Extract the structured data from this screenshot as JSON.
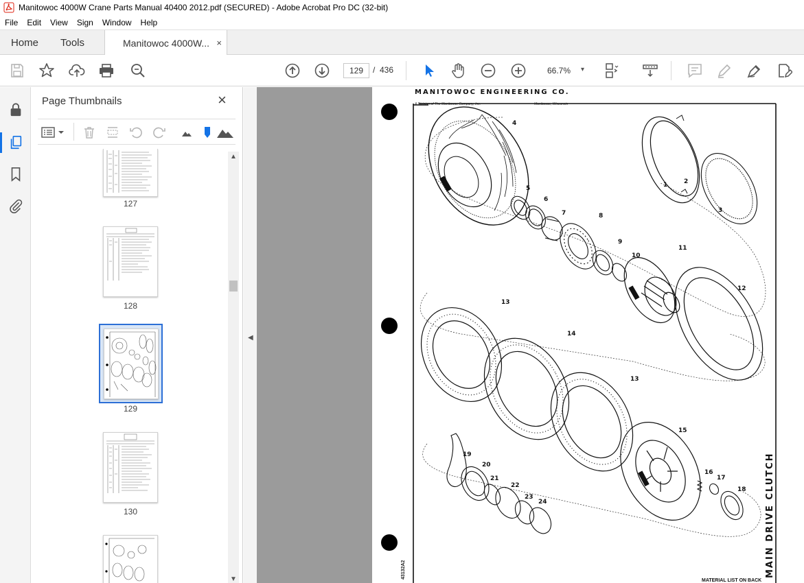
{
  "window": {
    "title": "Manitowoc 4000W Crane Parts Manual 40400 2012.pdf (SECURED) - Adobe Acrobat Pro DC (32-bit)"
  },
  "menu": {
    "items": [
      "File",
      "Edit",
      "View",
      "Sign",
      "Window",
      "Help"
    ]
  },
  "tabs": {
    "home": "Home",
    "tools": "Tools",
    "document": "Manitowoc 4000W...",
    "close": "×"
  },
  "toolbar": {
    "current_page": "129",
    "separator": "/",
    "total_pages": "436",
    "zoom": "66.7%",
    "zoom_chevron": "▾"
  },
  "panel": {
    "title": "Page Thumbnails",
    "close": "×",
    "thumbnails": [
      {
        "label": "127"
      },
      {
        "label": "128"
      },
      {
        "label": "129",
        "selected": true
      },
      {
        "label": "130"
      }
    ]
  },
  "document": {
    "company": "MANITOWOC ENGINEERING CO.",
    "division": "A Division of The Manitowoc Company, Inc.",
    "location": "Manitowoc, Wisconsin",
    "side_title": "MAIN DRIVE CLUTCH",
    "drawing_code": "43132A2",
    "footer": "MATERIAL LIST ON BACK",
    "part_numbers": [
      "1",
      "2",
      "3",
      "4",
      "5",
      "6",
      "7",
      "8",
      "9",
      "10",
      "11",
      "12",
      "13",
      "14",
      "13",
      "15",
      "16",
      "17",
      "18",
      "19",
      "20",
      "21",
      "22",
      "23",
      "24"
    ]
  },
  "colors": {
    "accent": "#1473e6",
    "canvas": "#9b9b9b",
    "tabbar": "#f0f0f0"
  }
}
